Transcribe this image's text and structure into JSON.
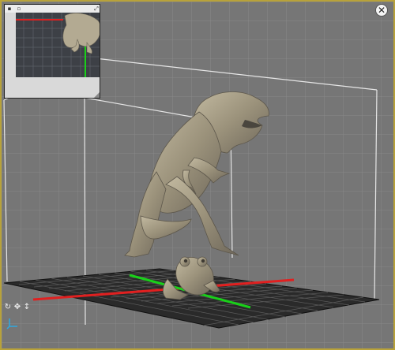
{
  "viewport": {
    "background_color": "#767676",
    "frame_color": "#b8a23a",
    "floor_grid_color": "#222222",
    "x_axis_color": "#e02020",
    "y_axis_color": "#19d019",
    "model_color": "#a9a08a"
  },
  "inset": {
    "toolbar_icons": [
      "camera-icon",
      "copy-icon",
      "expand-icon"
    ]
  },
  "controls": {
    "close_icon": "close-icon",
    "nav_icons": [
      "rotate-icon",
      "pan-icon",
      "zoom-icon"
    ],
    "axis_icon": "axis-triad-icon"
  }
}
